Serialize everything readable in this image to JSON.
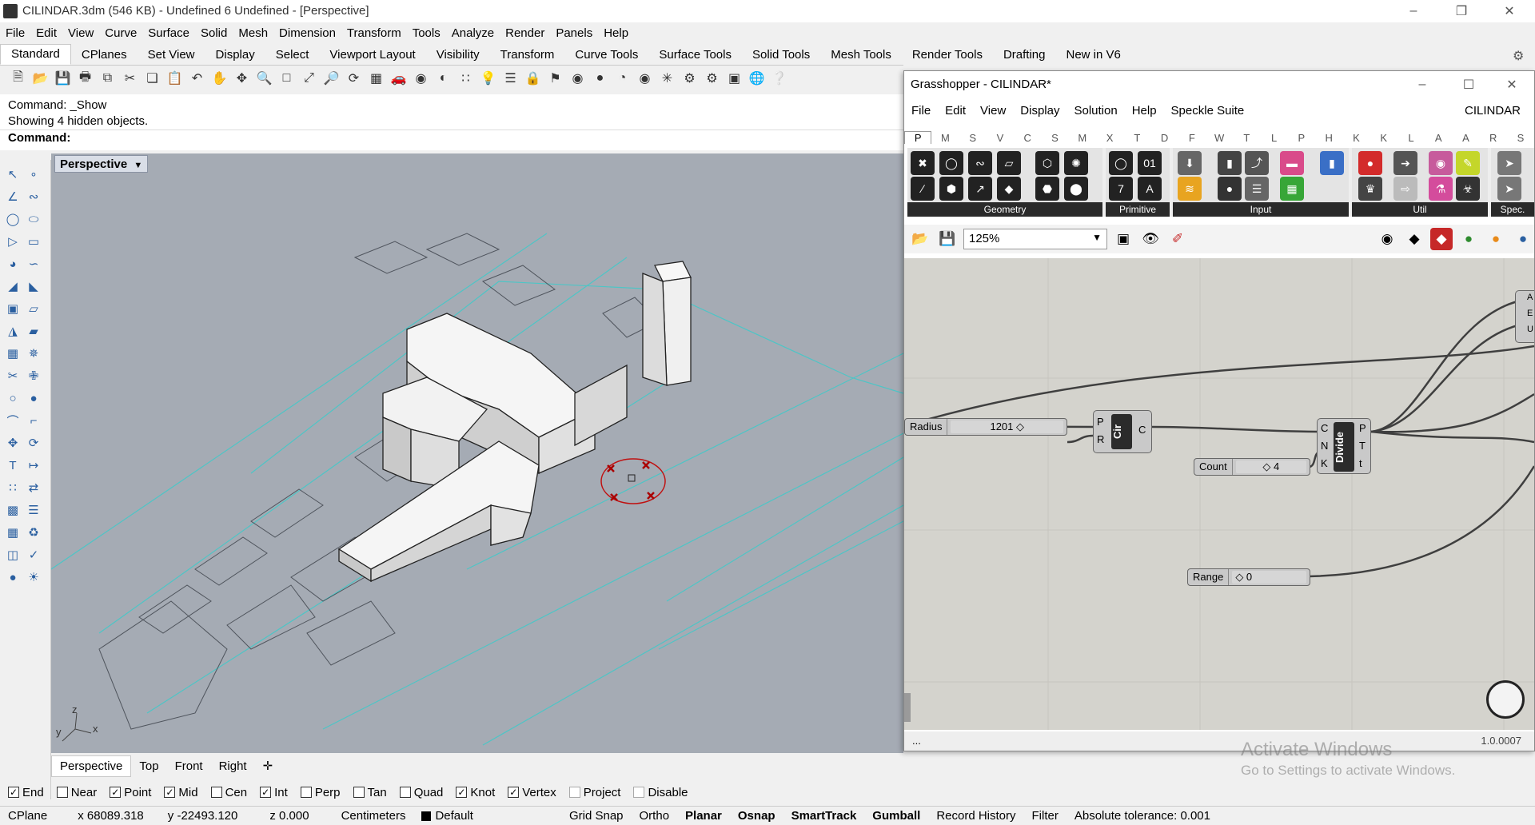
{
  "window": {
    "title": "CILINDAR.3dm (546 KB) - Undefined 6 Undefined - [Perspective]"
  },
  "menu": [
    "File",
    "Edit",
    "View",
    "Curve",
    "Surface",
    "Solid",
    "Mesh",
    "Dimension",
    "Transform",
    "Tools",
    "Analyze",
    "Render",
    "Panels",
    "Help"
  ],
  "tabs": [
    "Standard",
    "CPlanes",
    "Set View",
    "Display",
    "Select",
    "Viewport Layout",
    "Visibility",
    "Transform",
    "Curve Tools",
    "Surface Tools",
    "Solid Tools",
    "Mesh Tools",
    "Render Tools",
    "Drafting",
    "New in V6"
  ],
  "command": {
    "line1": "Command: _Show",
    "line2": "Showing 4 hidden objects.",
    "prompt": "Command:"
  },
  "viewport": {
    "label": "Perspective",
    "tabs": [
      "Perspective",
      "Top",
      "Front",
      "Right"
    ],
    "axes": {
      "x": "x",
      "y": "y",
      "z": "z"
    }
  },
  "osnaps": [
    {
      "label": "End",
      "checked": true
    },
    {
      "label": "Near",
      "checked": false
    },
    {
      "label": "Point",
      "checked": true
    },
    {
      "label": "Mid",
      "checked": true
    },
    {
      "label": "Cen",
      "checked": false
    },
    {
      "label": "Int",
      "checked": true
    },
    {
      "label": "Perp",
      "checked": false
    },
    {
      "label": "Tan",
      "checked": false
    },
    {
      "label": "Quad",
      "checked": false
    },
    {
      "label": "Knot",
      "checked": true
    },
    {
      "label": "Vertex",
      "checked": true
    },
    {
      "label": "Project",
      "checked": false
    },
    {
      "label": "Disable",
      "checked": false
    }
  ],
  "status": {
    "cplane": "CPlane",
    "x": "x 68089.318",
    "y": "y -22493.120",
    "z": "z 0.000",
    "units": "Centimeters",
    "layer": "Default",
    "grid_snap": "Grid Snap",
    "ortho": "Ortho",
    "planar": "Planar",
    "osnap": "Osnap",
    "smarttrack": "SmartTrack",
    "gumball": "Gumball",
    "record_history": "Record History",
    "filter": "Filter",
    "tolerance": "Absolute tolerance: 0.001"
  },
  "grasshopper": {
    "title": "Grasshopper - CILINDAR*",
    "menu": [
      "File",
      "Edit",
      "View",
      "Display",
      "Solution",
      "Help",
      "Speckle Suite"
    ],
    "doc_name": "CILINDAR",
    "categories": [
      "P",
      "M",
      "S",
      "V",
      "C",
      "S",
      "M",
      "X",
      "T",
      "D",
      "F",
      "W",
      "T",
      "L",
      "P",
      "H",
      "K",
      "K",
      "L",
      "A",
      "A",
      "R",
      "S"
    ],
    "ribbon_groups": [
      "Geometry",
      "Primitive",
      "Input",
      "Util",
      "Spec."
    ],
    "zoom": "125%",
    "version": "1.0.0007",
    "footer_left": "...",
    "nodes": {
      "circle": {
        "label": "Cir",
        "inputs": [
          "P",
          "R"
        ],
        "outputs": [
          "C"
        ]
      },
      "divide": {
        "label": "Divide",
        "inputs": [
          "C",
          "N",
          "K"
        ],
        "outputs": [
          "P",
          "T",
          "t"
        ]
      },
      "partial": {
        "outputs": [
          "A",
          "E",
          "U"
        ]
      }
    },
    "sliders": {
      "radius": {
        "name": "Radius",
        "value": "1201"
      },
      "count": {
        "name": "Count",
        "value": "4"
      },
      "range": {
        "name": "Range",
        "value": "0"
      }
    }
  },
  "watermark": {
    "line1": "Activate Windows",
    "line2": "Go to Settings to activate Windows."
  }
}
